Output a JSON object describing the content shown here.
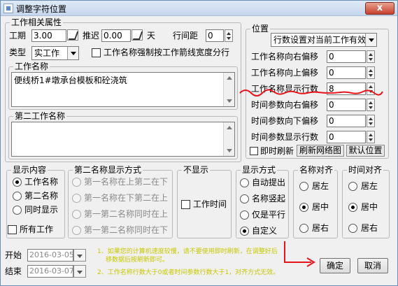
{
  "window": {
    "title": "调整字符位置",
    "close_label": "x"
  },
  "work_props": {
    "group_label": "工作相关属性",
    "duration_label": "工期",
    "duration_value": "3.00",
    "delay_label": "推迟",
    "delay_value": "0.00",
    "day_unit": "天",
    "line_spacing_label": "行间距",
    "line_spacing_value": "0",
    "type_label": "类型",
    "type_value": "实工作",
    "force_width_label": "工作名称强制按工作箭线宽度分行"
  },
  "work_name": {
    "group_label": "工作名称",
    "value": "便线桥1#墩承台模板和砼浇筑"
  },
  "second_name": {
    "group_label": "第二工作名称",
    "value": ""
  },
  "position": {
    "group_label": "位置",
    "mode_value": "行数设置对当前工作有效",
    "rows": [
      {
        "label": "工作名称向右偏移",
        "value": "0"
      },
      {
        "label": "工作名称向上偏移",
        "value": "0"
      },
      {
        "label": "工作名称显示行数",
        "value": "8"
      },
      {
        "label": "时间参数向右偏移",
        "value": "0"
      },
      {
        "label": "时间参数向下偏移",
        "value": "0"
      },
      {
        "label": "时间参数显示行数",
        "value": "0"
      }
    ],
    "instant_refresh_label": "即时刷新",
    "refresh_grid_label": "刷新网络图",
    "default_position_label": "默认位置"
  },
  "display_content": {
    "group_label": "显示内容",
    "options": [
      "工作名称",
      "第二名称",
      "同时显示"
    ],
    "selected": 0,
    "all_work_label": "所有工作"
  },
  "second_name_mode": {
    "group_label": "第二名称显示方式",
    "options": [
      "第一名称在上第二在下",
      "第一名称在下第二在上",
      "第一第二名称同时在上",
      "第一第二名称同时在下"
    ]
  },
  "hide": {
    "group_label": "不显示",
    "work_time_label": "工作时间"
  },
  "display_mode": {
    "group_label": "显示方式",
    "options": [
      "自动提出",
      "名称竖起",
      "仅是平行",
      "自定义"
    ],
    "selected": 3
  },
  "name_align": {
    "group_label": "名称对齐",
    "options": [
      "居左",
      "居中",
      "居右"
    ],
    "selected": 1
  },
  "time_align": {
    "group_label": "时间对齐",
    "options": [
      "居左",
      "居中",
      "居右"
    ],
    "selected": 1
  },
  "dates": {
    "start_label": "开始",
    "start_value": "2016-03-05",
    "end_label": "结束",
    "end_value": "2016-03-07"
  },
  "notes": {
    "line1": "1、如果您的计算机速度较慢，请不要使用即时刷新，在调整好后",
    "line1b": "移数据后按刷新即可。",
    "line2": "2、工作名称行数大于0或者时间参数行数大于1，对齐方式无效。"
  },
  "buttons": {
    "ok_label": "确定",
    "cancel_label": "取消"
  },
  "colors": {
    "annotation_red": "#e8141b",
    "note_yellow": "#c8c800"
  }
}
